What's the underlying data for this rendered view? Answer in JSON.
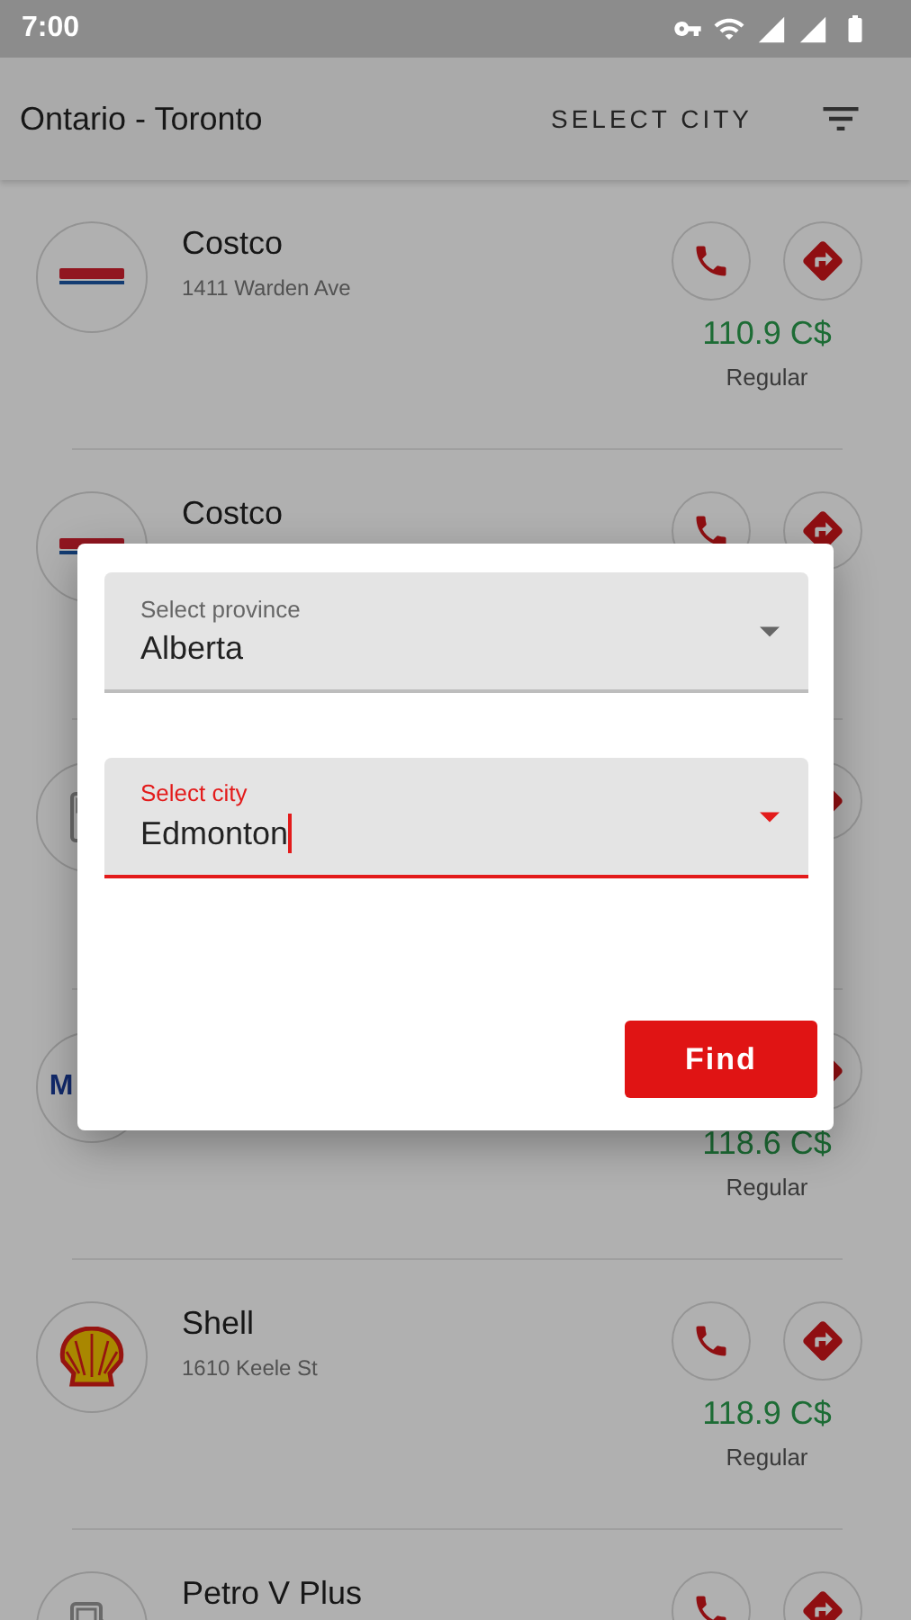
{
  "status_bar": {
    "time": "7:00"
  },
  "app_bar": {
    "title": "Ontario - Toronto",
    "action": "SELECT CITY"
  },
  "stations": [
    {
      "kind": "costco",
      "name": "Costco",
      "address": "1411 Warden Ave",
      "price": "110.9 C$",
      "grade": "Regular",
      "call_shown": true
    },
    {
      "kind": "costco",
      "name": "Costco",
      "call_shown": true
    },
    {
      "kind": "pump",
      "call_shown": false
    },
    {
      "kind": "text",
      "logo_text": "M",
      "price": "118.6 C$",
      "grade": "Regular",
      "call_shown": false
    },
    {
      "kind": "shell",
      "name": "Shell",
      "address": "1610 Keele St",
      "price": "118.9 C$",
      "grade": "Regular",
      "call_shown": true
    },
    {
      "kind": "pump",
      "name": "Petro V Plus",
      "call_shown": true
    }
  ],
  "dialog": {
    "fields": [
      {
        "label": "Select province",
        "value": "Alberta",
        "focused": false
      },
      {
        "label": "Select city",
        "value": "Edmonton",
        "focused": true
      }
    ],
    "button": "Find"
  }
}
